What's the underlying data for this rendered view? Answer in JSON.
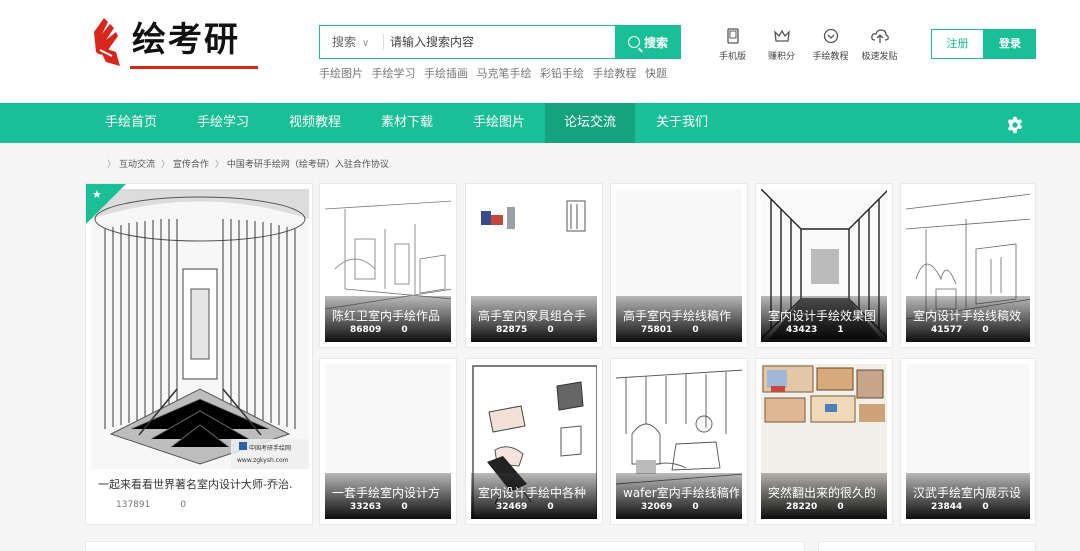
{
  "brand": {
    "logo_text": "绘考研",
    "accent": "#19bf96",
    "logo_red": "#d9261c"
  },
  "search": {
    "type_label": "搜索",
    "placeholder": "请输入搜索内容",
    "button_label": "搜索",
    "hot_words": [
      "手绘图片",
      "手绘学习",
      "手绘插画",
      "马克笔手绘",
      "彩铅手绘",
      "手绘教程",
      "快题"
    ]
  },
  "tools": [
    {
      "label": "手机版",
      "icon": "mobile-icon"
    },
    {
      "label": "赚积分",
      "icon": "crown-icon"
    },
    {
      "label": "手绘教程",
      "icon": "diamond-icon"
    },
    {
      "label": "极速发贴",
      "icon": "upload-cloud-icon"
    }
  ],
  "auth": {
    "register": "注册",
    "login": "登录"
  },
  "nav": {
    "items": [
      "手绘首页",
      "手绘学习",
      "视频教程",
      "素材下载",
      "手绘图片",
      "论坛交流",
      "关于我们"
    ],
    "active_index": 5,
    "settings_icon": "gear-icon"
  },
  "breadcrumb": [
    "互动交流",
    "宣传合作",
    "中国考研手绘网（绘考研）入驻合作协议"
  ],
  "featured": {
    "title": "一起来看看世界著名室内设计大师-乔治.",
    "views": "137891",
    "comments": "0",
    "watermark": "中国考研手绘网",
    "watermark_url": "www.zgkysh.com",
    "badge_icon": "star-icon"
  },
  "cards": [
    {
      "title": "陈红卫室内手绘作品",
      "views": "86809",
      "comments": "0"
    },
    {
      "title": "高手室内家具组合手",
      "views": "82875",
      "comments": "0"
    },
    {
      "title": "高手室内手绘线稿作",
      "views": "75801",
      "comments": "0"
    },
    {
      "title": "室内设计手绘效果图",
      "views": "43423",
      "comments": "1"
    },
    {
      "title": "室内设计手绘线稿效",
      "views": "41577",
      "comments": "0"
    },
    {
      "title": "一套手绘室内设计方",
      "views": "33263",
      "comments": "0"
    },
    {
      "title": "室内设计手绘中各种",
      "views": "32469",
      "comments": "0"
    },
    {
      "title": "wafer室内手绘线稿作",
      "views": "32069",
      "comments": "0"
    },
    {
      "title": "突然翻出来的很久的",
      "views": "28220",
      "comments": "0"
    },
    {
      "title": "汉武手绘室内展示设",
      "views": "23844",
      "comments": "0"
    }
  ]
}
